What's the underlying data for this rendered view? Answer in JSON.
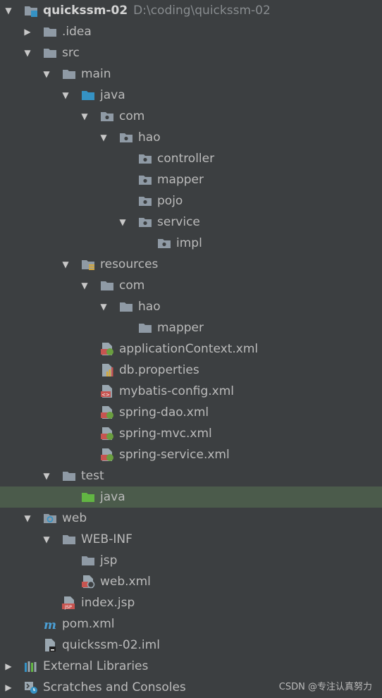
{
  "project": {
    "name": "quickssm-02",
    "path": "D:\\coding\\quickssm-02"
  },
  "items": [
    {
      "label": "quickssm-02",
      "icon": "module-folder-icon"
    },
    {
      "label": ".idea",
      "icon": "folder-icon"
    },
    {
      "label": "src",
      "icon": "folder-icon"
    },
    {
      "label": "main",
      "icon": "folder-icon"
    },
    {
      "label": "java",
      "icon": "source-root-folder-icon"
    },
    {
      "label": "com",
      "icon": "package-icon"
    },
    {
      "label": "hao",
      "icon": "package-icon"
    },
    {
      "label": "controller",
      "icon": "package-icon"
    },
    {
      "label": "mapper",
      "icon": "package-icon"
    },
    {
      "label": "pojo",
      "icon": "package-icon"
    },
    {
      "label": "service",
      "icon": "package-icon"
    },
    {
      "label": "impl",
      "icon": "package-icon"
    },
    {
      "label": "resources",
      "icon": "resources-root-folder-icon"
    },
    {
      "label": "com",
      "icon": "folder-icon"
    },
    {
      "label": "hao",
      "icon": "folder-icon"
    },
    {
      "label": "mapper",
      "icon": "folder-icon"
    },
    {
      "label": "applicationContext.xml",
      "icon": "spring-xml-icon"
    },
    {
      "label": "db.properties",
      "icon": "properties-file-icon"
    },
    {
      "label": "mybatis-config.xml",
      "icon": "xml-file-icon"
    },
    {
      "label": "spring-dao.xml",
      "icon": "spring-xml-icon"
    },
    {
      "label": "spring-mvc.xml",
      "icon": "spring-xml-icon"
    },
    {
      "label": "spring-service.xml",
      "icon": "spring-xml-icon"
    },
    {
      "label": "test",
      "icon": "folder-icon"
    },
    {
      "label": "java",
      "icon": "test-root-folder-icon"
    },
    {
      "label": "web",
      "icon": "web-folder-icon"
    },
    {
      "label": "WEB-INF",
      "icon": "folder-icon"
    },
    {
      "label": "jsp",
      "icon": "folder-icon"
    },
    {
      "label": "web.xml",
      "icon": "web-xml-icon"
    },
    {
      "label": "index.jsp",
      "icon": "jsp-file-icon"
    },
    {
      "label": "pom.xml",
      "icon": "maven-icon"
    },
    {
      "label": "quickssm-02.iml",
      "icon": "iml-file-icon"
    },
    {
      "label": "External Libraries",
      "icon": "libraries-icon"
    },
    {
      "label": "Scratches and Consoles",
      "icon": "scratches-icon"
    }
  ],
  "watermark": "CSDN @专注认真努力",
  "colors": {
    "background": "#3c3f41",
    "selection": "#4b5b4b",
    "text": "#bbbbbb"
  }
}
